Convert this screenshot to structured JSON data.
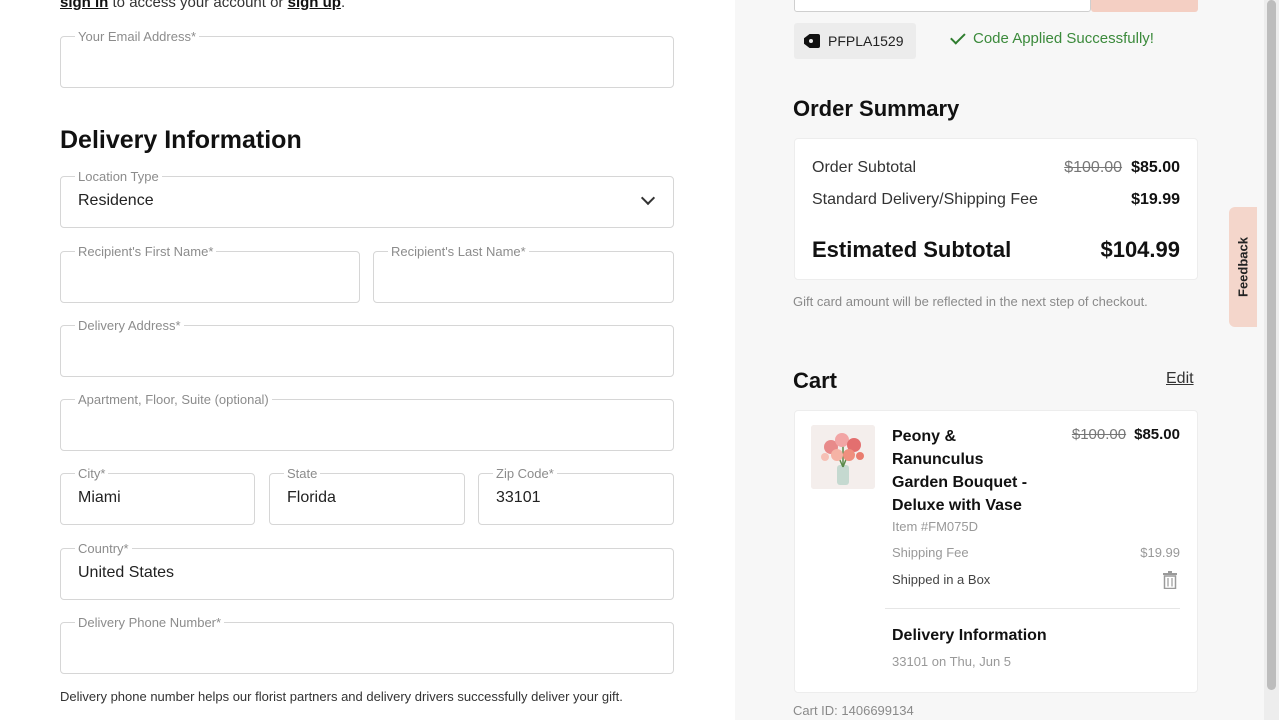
{
  "account": {
    "signin_link": "sign in",
    "middle_text": " to access your account or ",
    "signup_link": "sign up",
    "end": "."
  },
  "email": {
    "label": "Your Email Address*",
    "value": ""
  },
  "delivery": {
    "title": "Delivery Information",
    "location_type": {
      "label": "Location Type",
      "value": "Residence"
    },
    "first_name": {
      "label": "Recipient's First Name*",
      "value": ""
    },
    "last_name": {
      "label": "Recipient's Last Name*",
      "value": ""
    },
    "address": {
      "label": "Delivery Address*",
      "value": ""
    },
    "apartment": {
      "label": "Apartment, Floor, Suite (optional)",
      "value": ""
    },
    "city": {
      "label": "City*",
      "value": "Miami"
    },
    "state": {
      "label": "State",
      "value": "Florida"
    },
    "zip": {
      "label": "Zip Code*",
      "value": "33101"
    },
    "country": {
      "label": "Country*",
      "value": "United States"
    },
    "phone": {
      "label": "Delivery Phone Number*",
      "value": ""
    },
    "phone_note": "Delivery phone number helps our florist partners and delivery drivers successfully deliver your gift."
  },
  "promo": {
    "code": "PFPLA1529",
    "applied_message": "Code Applied Successfully!"
  },
  "order_summary": {
    "title": "Order Summary",
    "subtotal_label": "Order Subtotal",
    "subtotal_original": "$100.00",
    "subtotal_price": "$85.00",
    "shipping_label": "Standard Delivery/Shipping Fee",
    "shipping_price": "$19.99",
    "estimated_label": "Estimated Subtotal",
    "estimated_price": "$104.99",
    "gift_card_note": "Gift card amount will be reflected in the next step of checkout."
  },
  "cart": {
    "title": "Cart",
    "edit_label": "Edit",
    "item": {
      "name": "Peony & Ranunculus Garden Bouquet - Deluxe with Vase",
      "item_number": "Item #FM075D",
      "original_price": "$100.00",
      "price": "$85.00",
      "shipping_label": "Shipping Fee",
      "shipping_value": "$19.99",
      "shipped_in": "Shipped in a Box"
    },
    "delivery_title": "Delivery Information",
    "delivery_detail": "33101 on Thu, Jun 5",
    "cart_id": "Cart ID: 1406699134"
  },
  "feedback_label": "Feedback",
  "colors": {
    "accent": "#f4cfc3",
    "success": "#3b8a3b"
  }
}
